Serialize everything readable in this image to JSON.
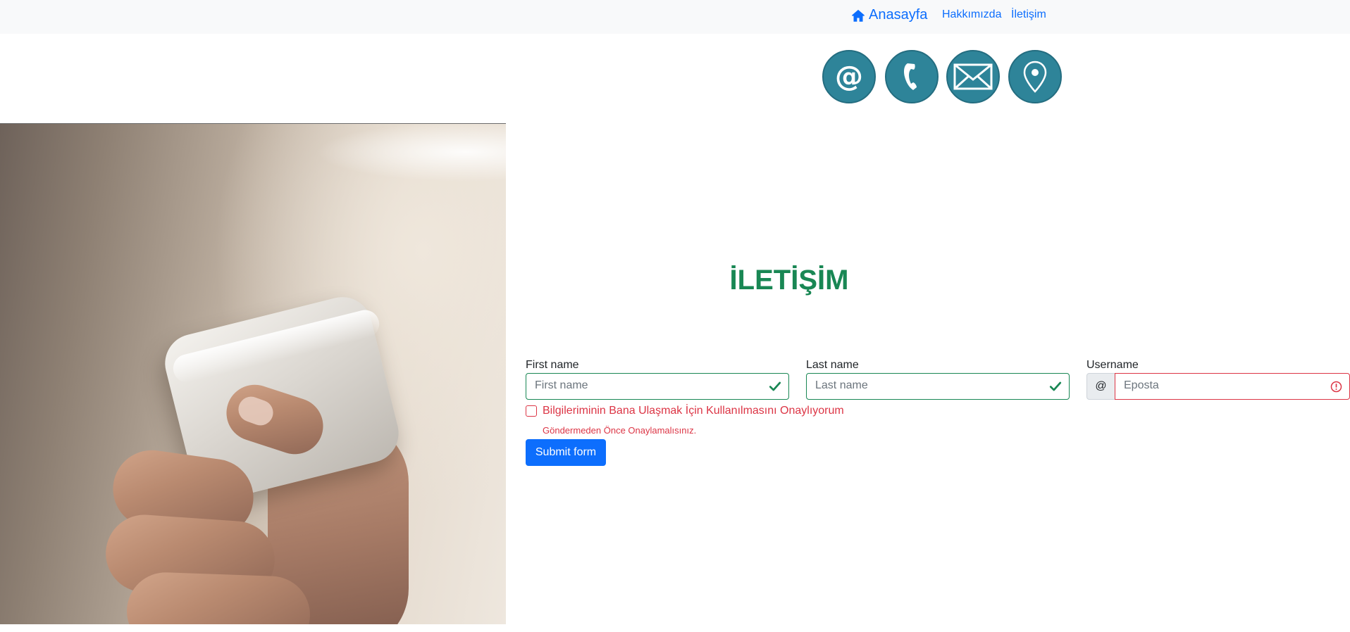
{
  "navbar": {
    "brand": "Anasayfa",
    "brand_icon": "home-icon",
    "links": [
      "Hakkımızda",
      "İletişim"
    ]
  },
  "contact_icons": [
    "at-sign-icon",
    "phone-icon",
    "envelope-icon",
    "location-pin-icon"
  ],
  "hero": {
    "image": "hand-holding-phone"
  },
  "page_title": "İLETİŞİM",
  "form": {
    "first_name": {
      "label": "First name",
      "placeholder": "First name",
      "state": "valid"
    },
    "last_name": {
      "label": "Last name",
      "placeholder": "Last name",
      "state": "valid"
    },
    "username": {
      "label": "Username",
      "prefix": "@",
      "placeholder": "Eposta",
      "state": "invalid"
    },
    "consent_checkbox": {
      "label": "Bilgileriminin Bana Ulaşmak İçin Kullanılmasını Onaylıyorum",
      "checked": false,
      "feedback": "Göndermeden Önce Onaylamalısınız."
    },
    "submit_label": "Submit form"
  },
  "colors": {
    "primary": "#0d6efd",
    "success": "#198754",
    "danger": "#dc3545",
    "icon_circle": "#2e8499",
    "navbar_bg": "#f8f9fa"
  }
}
